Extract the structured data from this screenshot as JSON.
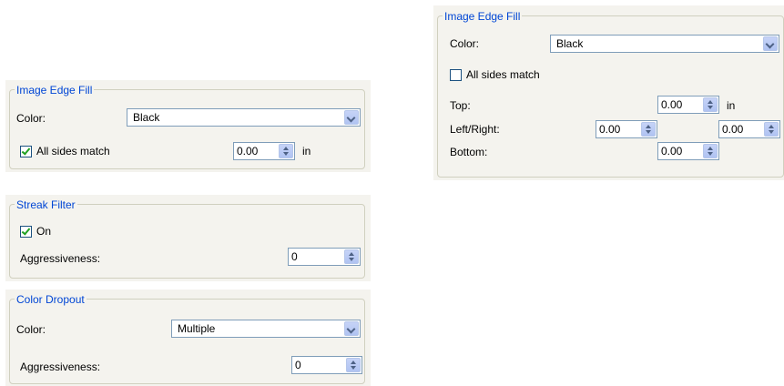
{
  "left_image_edge_fill": {
    "title": "Image Edge Fill",
    "color_label": "Color:",
    "color_value": "Black",
    "all_sides_label": "All sides match",
    "all_sides_checked": true,
    "amount_value": "0.00",
    "unit": "in"
  },
  "streak_filter": {
    "title": "Streak Filter",
    "on_label": "On",
    "on_checked": true,
    "aggressiveness_label": "Aggressiveness:",
    "aggressiveness_value": "0"
  },
  "color_dropout": {
    "title": "Color Dropout",
    "color_label": "Color:",
    "color_value": "Multiple",
    "aggressiveness_label": "Aggressiveness:",
    "aggressiveness_value": "0"
  },
  "right_image_edge_fill": {
    "title": "Image Edge Fill",
    "color_label": "Color:",
    "color_value": "Black",
    "all_sides_label": "All sides match",
    "all_sides_checked": false,
    "top_label": "Top:",
    "top_value": "0.00",
    "unit": "in",
    "left_right_label": "Left/Right:",
    "left_value": "0.00",
    "right_value": "0.00",
    "bottom_label": "Bottom:",
    "bottom_value": "0.00"
  }
}
